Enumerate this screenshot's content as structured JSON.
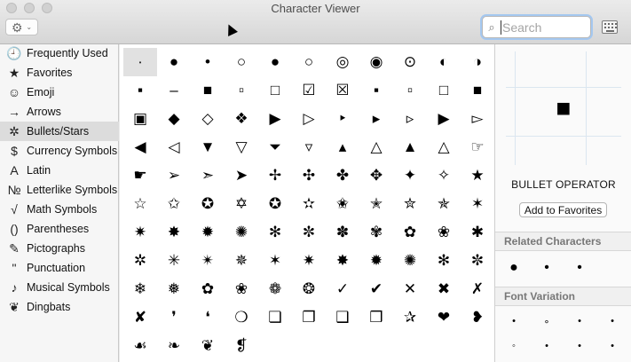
{
  "window": {
    "title": "Character Viewer",
    "search_placeholder": "Search",
    "gear_glyph": "⚙",
    "chevron_glyph": "⌄",
    "search_glyph": "⌕"
  },
  "sidebar": {
    "items": [
      {
        "label": "Frequently Used",
        "icon": "clock-icon",
        "glyph": "🕘"
      },
      {
        "label": "Favorites",
        "icon": "star-icon",
        "glyph": "★"
      },
      {
        "label": "Emoji",
        "icon": "smiley-icon",
        "glyph": "☺"
      },
      {
        "label": "Arrows",
        "icon": "arrow-icon",
        "glyph": "→"
      },
      {
        "label": "Bullets/Stars",
        "icon": "asterisk-icon",
        "glyph": "✲"
      },
      {
        "label": "Currency Symbols",
        "icon": "dollar-icon",
        "glyph": "$"
      },
      {
        "label": "Latin",
        "icon": "latin-a-icon",
        "glyph": "A"
      },
      {
        "label": "Letterlike Symbols",
        "icon": "numero-icon",
        "glyph": "№"
      },
      {
        "label": "Math Symbols",
        "icon": "square-root-icon",
        "glyph": "√"
      },
      {
        "label": "Parentheses",
        "icon": "parentheses-icon",
        "glyph": "()"
      },
      {
        "label": "Pictographs",
        "icon": "pencil-icon",
        "glyph": "✎"
      },
      {
        "label": "Punctuation",
        "icon": "punctuation-icon",
        "glyph": "\""
      },
      {
        "label": "Musical Symbols",
        "icon": "music-note-icon",
        "glyph": "♪"
      },
      {
        "label": "Dingbats",
        "icon": "floral-heart-icon",
        "glyph": "❦"
      }
    ],
    "selected_index": 4
  },
  "grid": {
    "columns": 11,
    "selected_index": 0,
    "chars": [
      "∙",
      "●",
      "•",
      "○",
      "●",
      "○",
      "◎",
      "◉",
      "⊙",
      "◐",
      "◑",
      "▪",
      "‒",
      "■",
      "▫",
      "□",
      "☑",
      "☒",
      "▪",
      "▫",
      "□",
      "■",
      "▣",
      "◆",
      "◇",
      "❖",
      "▶",
      "▷",
      "‣",
      "▸",
      "▹",
      "▶",
      "▻",
      "◀",
      "◁",
      "▼",
      "▽",
      "⏷",
      "▿",
      "▴",
      "△",
      "▲",
      "△",
      "☞",
      "☛",
      "➢",
      "➣",
      "➤",
      "✢",
      "✣",
      "✤",
      "✥",
      "✦",
      "✧",
      "★",
      "☆",
      "✩",
      "✪",
      "✡",
      "✪",
      "✫",
      "✬",
      "✭",
      "✮",
      "✯",
      "✶",
      "✷",
      "✸",
      "✹",
      "✺",
      "✻",
      "✼",
      "✽",
      "✾",
      "✿",
      "❀",
      "✱",
      "✲",
      "✳",
      "✴",
      "✵",
      "✶",
      "✷",
      "✸",
      "✹",
      "✺",
      "✻",
      "✼",
      "❄",
      "❅",
      "✿",
      "❀",
      "❁",
      "❂",
      "✓",
      "✔",
      "✕",
      "✖",
      "✗",
      "✘",
      "❜",
      "❛",
      "❍",
      "❏",
      "❐",
      "❑",
      "❒",
      "✰",
      "❤",
      "❥",
      "☙",
      "❧",
      "❦",
      "❡"
    ]
  },
  "detail": {
    "preview_glyph": "■",
    "char_name": "BULLET OPERATOR",
    "add_favorites_label": "Add to Favorites",
    "related_title": "Related Characters",
    "related_chars": [
      "●",
      "•",
      "•"
    ],
    "font_variation_title": "Font Variation",
    "font_variations": [
      "•",
      "∘",
      "•",
      "•",
      "•",
      "◦",
      "•",
      "•",
      "•"
    ]
  }
}
